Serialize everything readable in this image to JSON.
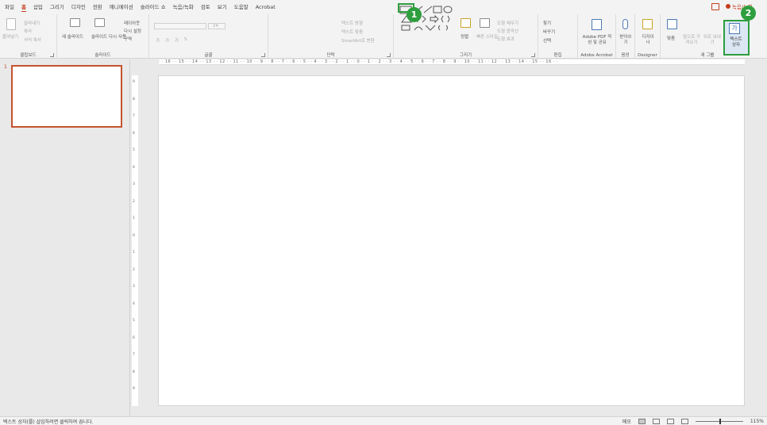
{
  "tabs": [
    "파일",
    "홈",
    "삽입",
    "그리기",
    "디자인",
    "전환",
    "애니메이션",
    "슬라이드 쇼",
    "녹음/녹화",
    "검토",
    "보기",
    "도움말",
    "Acrobat"
  ],
  "active_tab": "홈",
  "tabs_right": {
    "record_label": "녹음/녹화"
  },
  "ribbon": {
    "clipboard": {
      "label": "클립보드",
      "paste": "붙여넣기",
      "cut": "잘라내기",
      "copy": "복사",
      "format_painter": "서식 복사"
    },
    "slides": {
      "label": "슬라이드",
      "new_slide": "새 슬라이드",
      "reuse_slide": "슬라이드 다시 사용",
      "layout": "레이아웃",
      "reset": "다시 설정",
      "section": "구역"
    },
    "font": {
      "label": "글꼴",
      "font_size": "24",
      "bold": "가",
      "italic": "가",
      "underline": "가",
      "strike": "S"
    },
    "paragraph": {
      "label": "단락",
      "text_direction": "텍스트 방향",
      "align_text": "텍스트 맞춤",
      "smartart": "SmartArt로 변환"
    },
    "drawing": {
      "label": "그리기",
      "arrange": "정렬",
      "quick_styles": "빠른 스타일",
      "shape_fill": "도형 채우기",
      "shape_outline": "도형 윤곽선",
      "shape_effects": "도형 효과"
    },
    "editing": {
      "label": "편집",
      "find": "찾기",
      "replace": "바꾸기",
      "select": "선택"
    },
    "acrobat": {
      "label": "Adobe Acrobat",
      "create_pdf": "Adobe PDF 작성 및 공유"
    },
    "voice": {
      "label": "음성",
      "dictate": "받아쓰기"
    },
    "designer": {
      "label": "Designer",
      "designer_btn": "디자이너"
    },
    "new_group": {
      "label": "새 그룹",
      "align": "맞춤",
      "bring": "앞으로 가져오기",
      "send": "뒤로 보내기",
      "textbox": "텍스트 상자"
    }
  },
  "annotations": {
    "badge1": "1",
    "badge2": "2"
  },
  "textbox_icon_glyph": "가",
  "ruler_text": "· · 16 · · 15 · · 14 · · 13 · · 12 · · 11 · · 10 · · 9 · · 8 · · 7 · · 6 · · 5 · · 4 · · 3 · · 2 · · 1 · · 0 · · 1 · · 2 · · 3 · · 4 · · 5 · · 6 · · 7 · · 8 · · 9 · · 10 · · 11 · · 12 · · 13 · · 14 · · 15 · · 16 · ·",
  "ruler_left_numbers": [
    "9",
    "8",
    "7",
    "6",
    "5",
    "4",
    "3",
    "2",
    "1",
    "0",
    "1",
    "2",
    "3",
    "4",
    "5",
    "6",
    "7",
    "8",
    "9"
  ],
  "thumbnail": {
    "number": "1"
  },
  "status": {
    "hint": "텍스트 상자(를) 삽입하려면 클릭하여 끕니다.",
    "notes": "메모",
    "zoom": "115%"
  },
  "colors": {
    "accent": "#c43e1c",
    "highlight": "#2e9e3e"
  }
}
